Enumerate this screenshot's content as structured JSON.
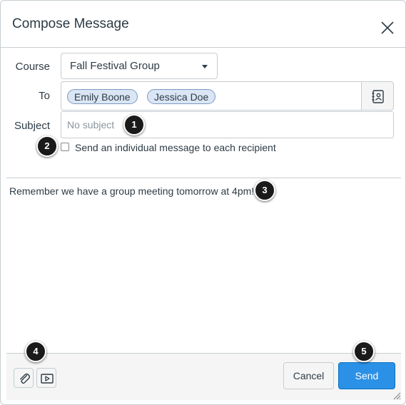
{
  "dialog": {
    "title": "Compose Message",
    "close_icon": "close-icon"
  },
  "form": {
    "course_label": "Course",
    "course_value": "Fall Festival Group",
    "to_label": "To",
    "recipients": [
      "Emily Boone",
      "Jessica Doe"
    ],
    "address_book_icon": "address-book-icon",
    "subject_label": "Subject",
    "subject_value": "",
    "subject_placeholder": "No subject",
    "individual_checkbox_label": "Send an individual message to each recipient",
    "individual_checked": false
  },
  "message": {
    "body": "Remember we have a group meeting tomorrow at 4pm!"
  },
  "footer": {
    "attach_icon": "paperclip-icon",
    "media_icon": "media-icon",
    "cancel_label": "Cancel",
    "send_label": "Send"
  },
  "callouts": [
    "1",
    "2",
    "3",
    "4",
    "5"
  ],
  "colors": {
    "accent": "#2b91e6",
    "token_bg": "#dbe6f5",
    "token_border": "#7b9ac4",
    "footer_bg": "#f5f5f5",
    "border": "#c7cdd1"
  }
}
